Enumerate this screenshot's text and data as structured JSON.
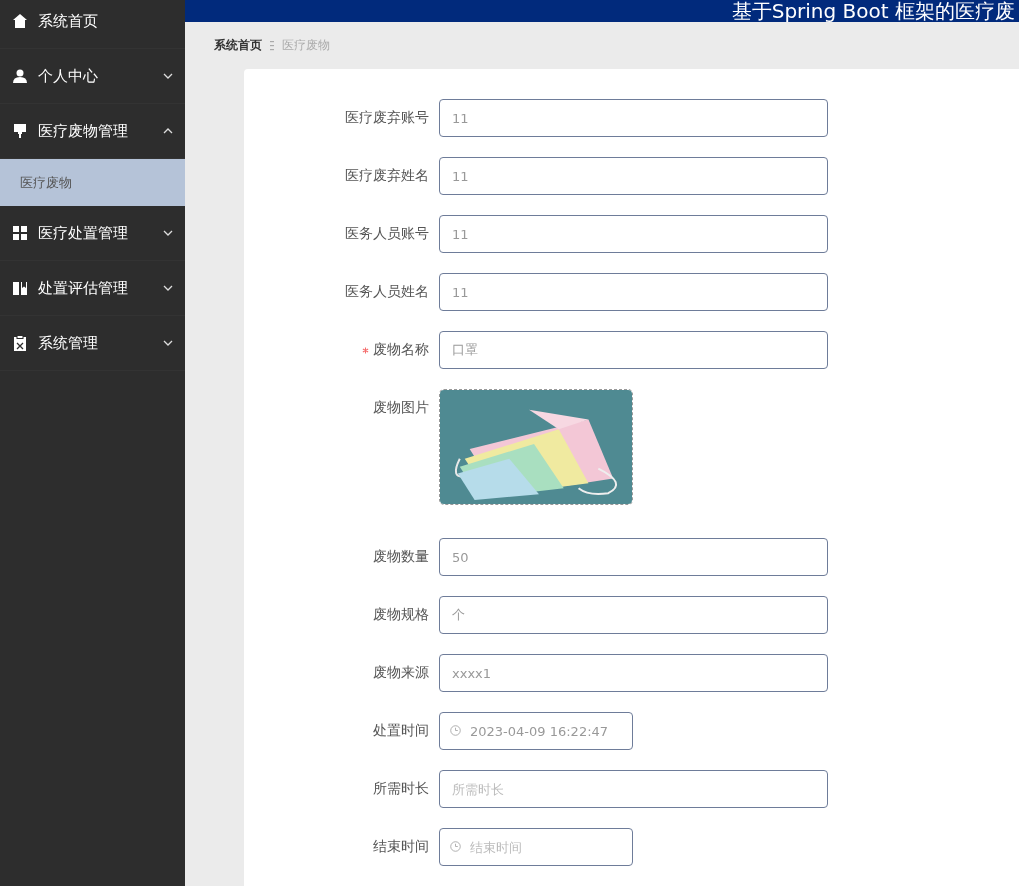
{
  "header": {
    "title": "基于Spring Boot 框架的医疗废"
  },
  "sidebar": {
    "items": [
      {
        "label": "系统首页",
        "has_arrow": false
      },
      {
        "label": "个人中心",
        "expanded": false,
        "has_arrow": true
      },
      {
        "label": "医疗废物管理",
        "expanded": true,
        "has_arrow": true,
        "children": [
          {
            "label": "医疗废物",
            "selected": true
          }
        ]
      },
      {
        "label": "医疗处置管理",
        "expanded": false,
        "has_arrow": true
      },
      {
        "label": "处置评估管理",
        "expanded": false,
        "has_arrow": true
      },
      {
        "label": "系统管理",
        "expanded": false,
        "has_arrow": true
      }
    ]
  },
  "breadcrumb": [
    "系统首页",
    "医疗废物"
  ],
  "form": {
    "fields": [
      {
        "kind": "text",
        "label": "医疗废弃账号",
        "value": "11",
        "required": false
      },
      {
        "kind": "text",
        "label": "医疗废弃姓名",
        "value": "11",
        "required": false
      },
      {
        "kind": "text",
        "label": "医务人员账号",
        "value": "11",
        "required": false
      },
      {
        "kind": "text",
        "label": "医务人员姓名",
        "value": "11",
        "required": false
      },
      {
        "kind": "text",
        "label": "废物名称",
        "value": "口罩",
        "required": true
      },
      {
        "label": "废物图片",
        "required": false
      },
      {
        "kind": "text",
        "label": "废物数量",
        "value": "50",
        "required": false
      },
      {
        "kind": "text",
        "label": "废物规格",
        "value": "个",
        "required": false
      },
      {
        "kind": "text",
        "label": "废物来源",
        "value": "xxxx1",
        "required": false
      },
      {
        "kind": "datetime",
        "label": "处置时间",
        "value": "2023-04-09 16:22:47",
        "required": false
      },
      {
        "kind": "text",
        "label": "所需时长",
        "placeholder": "所需时长",
        "required": false
      },
      {
        "kind": "datetime",
        "label": "结束时间",
        "placeholder": "结束时间",
        "required": false
      }
    ]
  }
}
